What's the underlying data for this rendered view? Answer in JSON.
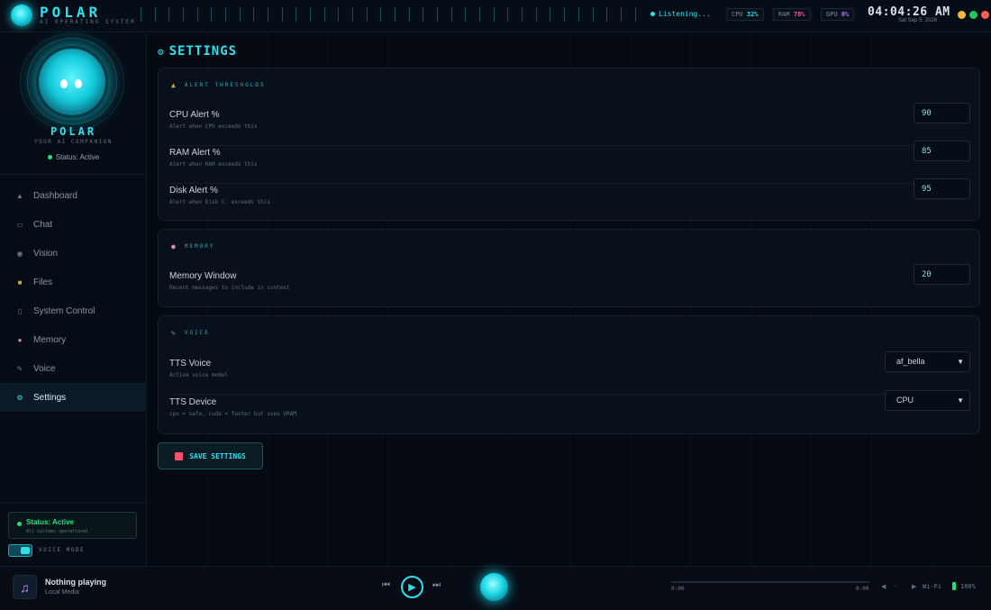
{
  "app": {
    "title": "POLAR",
    "subtitle": "AI OPERATING SYSTEM",
    "listening": "Listening...",
    "stats": [
      {
        "label": "CPU",
        "value": "32%",
        "color": "#2fe0ee"
      },
      {
        "label": "RAM",
        "value": "78%",
        "color": "#ff4fb0"
      },
      {
        "label": "GPU",
        "value": "0%",
        "color": "#b07bff"
      }
    ],
    "clock": "04:04:26 AM",
    "date": "Sat Sep 5, 2026",
    "window_dots": [
      "#f5b83d",
      "#22c55e",
      "#ff5f57"
    ]
  },
  "sidebar": {
    "name": "POLAR",
    "tagline": "YOUR AI COMPANION",
    "status": "Status: Active",
    "nav": [
      {
        "label": "Dashboard",
        "icon": "home-icon"
      },
      {
        "label": "Chat",
        "icon": "chat-icon"
      },
      {
        "label": "Vision",
        "icon": "eye-icon"
      },
      {
        "label": "Files",
        "icon": "folder-icon"
      },
      {
        "label": "System Control",
        "icon": "phone-icon"
      },
      {
        "label": "Memory",
        "icon": "brain-icon"
      },
      {
        "label": "Voice",
        "icon": "microphone-icon"
      },
      {
        "label": "Settings",
        "icon": "gear-icon",
        "active": true
      }
    ],
    "status_card": {
      "title": "Status: Active",
      "subtitle": "All systems operational"
    },
    "voice_mode": "VOICE MODE"
  },
  "settings": {
    "title": "SETTINGS",
    "alerts": {
      "heading": "ALERT THRESHOLDS",
      "rows": [
        {
          "label": "CPU Alert %",
          "hint": "Alert when CPU exceeds this",
          "value": "90"
        },
        {
          "label": "RAM Alert %",
          "hint": "Alert when RAM exceeds this",
          "value": "85"
        },
        {
          "label": "Disk Alert %",
          "hint": "Alert when Disk C: exceeds this",
          "value": "95"
        }
      ]
    },
    "memory": {
      "heading": "MEMORY",
      "rows": [
        {
          "label": "Memory Window",
          "hint": "Recent messages to include in context",
          "value": "20"
        }
      ]
    },
    "voice": {
      "heading": "VOICE",
      "rows": [
        {
          "label": "TTS Voice",
          "hint": "Active voice model",
          "value": "af_bella"
        },
        {
          "label": "TTS Device",
          "hint": "cpu = safe, cuda = faster but uses VRAM",
          "value": "CPU"
        }
      ]
    },
    "save_label": "SAVE SETTINGS"
  },
  "player": {
    "track": "Nothing playing",
    "source": "Local Media",
    "time_current": "0:00",
    "time_total": "0:00",
    "progress": 0,
    "wifi": "Wi-Fi",
    "battery": "100%"
  }
}
